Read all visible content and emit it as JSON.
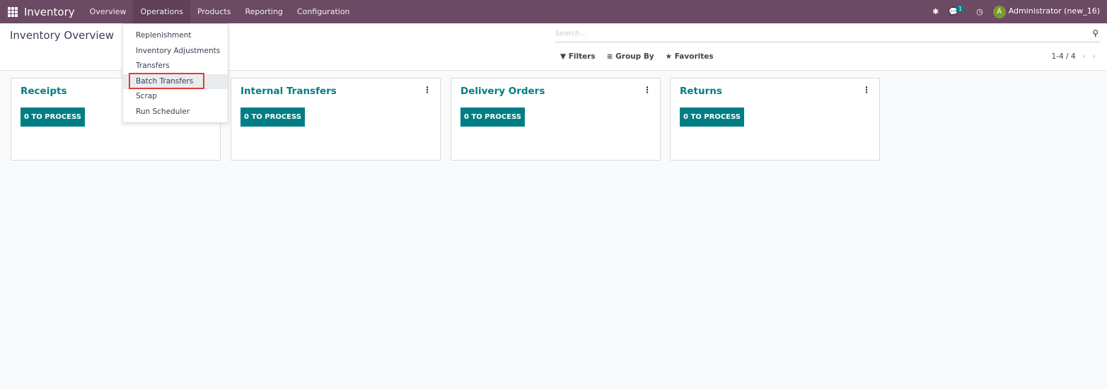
{
  "navbar": {
    "app": "Inventory",
    "menus": [
      "Overview",
      "Operations",
      "Products",
      "Reporting",
      "Configuration"
    ],
    "active_menu": "Operations",
    "chat_count": "1",
    "user_initial": "A",
    "user": "Administrator (new_16)"
  },
  "control_panel": {
    "title": "Inventory Overview",
    "search_placeholder": "Search...",
    "filters": "Filters",
    "group_by": "Group By",
    "favorites": "Favorites",
    "pager": "1-4 / 4"
  },
  "operations_menu": {
    "items": [
      "Replenishment",
      "Inventory Adjustments",
      "Transfers",
      "Batch Transfers",
      "Scrap",
      "Run Scheduler"
    ],
    "highlighted": "Batch Transfers"
  },
  "cards": [
    {
      "title": "Receipts",
      "button": "0 TO PROCESS"
    },
    {
      "title": "Internal Transfers",
      "button": "0 TO PROCESS"
    },
    {
      "title": "Delivery Orders",
      "button": "0 TO PROCESS"
    },
    {
      "title": "Returns",
      "button": "0 TO PROCESS"
    }
  ],
  "colors": {
    "navbar": "#6b4a63",
    "accent": "#017e84",
    "highlight_box": "#e53935"
  }
}
